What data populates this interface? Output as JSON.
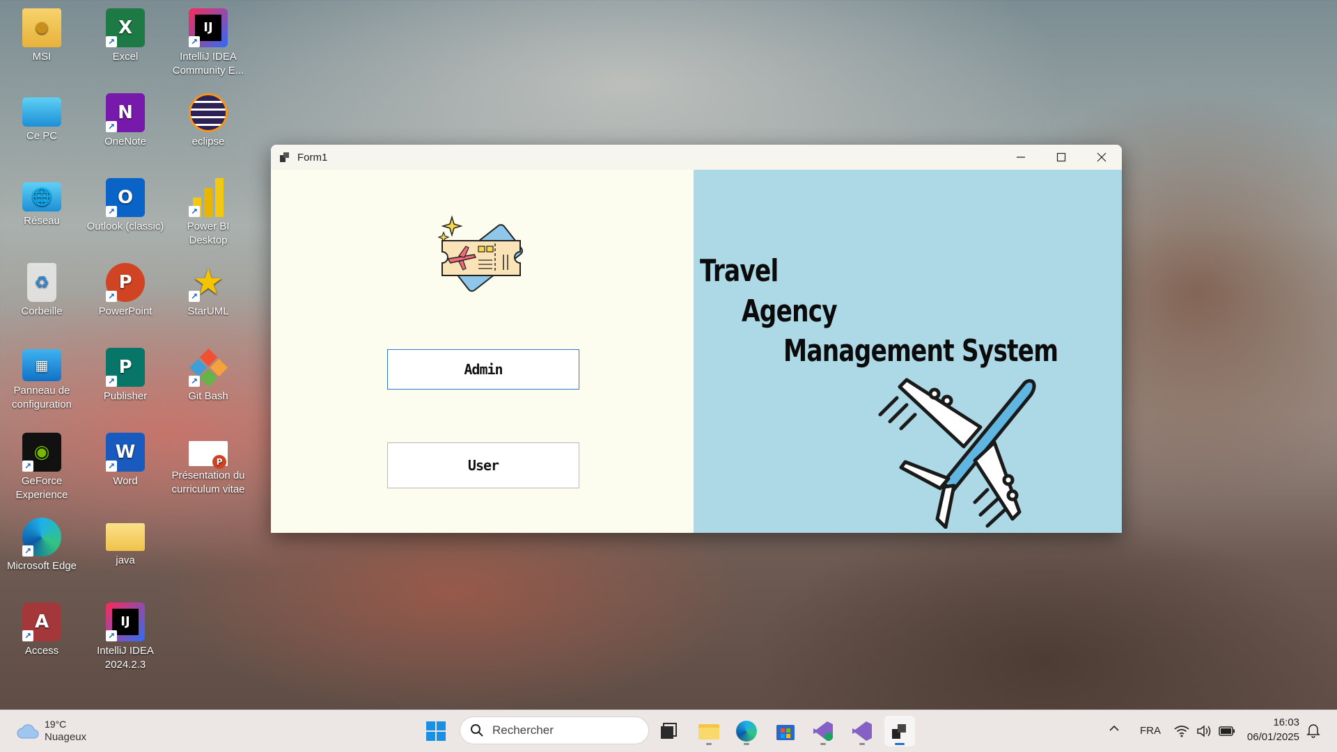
{
  "desktop": {
    "icons": [
      {
        "label": "MSI",
        "icon": "folder-user-icon"
      },
      {
        "label": "Excel",
        "icon": "excel-icon"
      },
      {
        "label": "IntelliJ IDEA Community E...",
        "icon": "intellij-icon"
      },
      {
        "label": "Ce PC",
        "icon": "monitor-icon"
      },
      {
        "label": "OneNote",
        "icon": "onenote-icon"
      },
      {
        "label": "eclipse",
        "icon": "eclipse-icon"
      },
      {
        "label": "Réseau",
        "icon": "network-icon"
      },
      {
        "label": "Outlook (classic)",
        "icon": "outlook-icon"
      },
      {
        "label": "Power BI Desktop",
        "icon": "powerbi-icon"
      },
      {
        "label": "Corbeille",
        "icon": "recycle-bin-icon"
      },
      {
        "label": "PowerPoint",
        "icon": "powerpoint-icon"
      },
      {
        "label": "StarUML",
        "icon": "staruml-icon"
      },
      {
        "label": "Panneau de configuration",
        "icon": "control-panel-icon"
      },
      {
        "label": "Publisher",
        "icon": "publisher-icon"
      },
      {
        "label": "Git Bash",
        "icon": "git-bash-icon"
      },
      {
        "label": "GeForce Experience",
        "icon": "geforce-icon"
      },
      {
        "label": "Word",
        "icon": "word-icon"
      },
      {
        "label": "Présentation du curriculum vitae",
        "icon": "pptx-file-icon"
      },
      {
        "label": "Microsoft Edge",
        "icon": "edge-icon"
      },
      {
        "label": "java",
        "icon": "folder-icon"
      },
      {
        "label": "Access",
        "icon": "access-icon"
      },
      {
        "label": "IntelliJ IDEA 2024.2.3",
        "icon": "intellij-icon"
      }
    ]
  },
  "window": {
    "title": "Form1",
    "buttons": {
      "admin": "Admin",
      "user": "User"
    },
    "headline": {
      "line1": "Travel",
      "line2": "Agency",
      "line3": "Management System"
    }
  },
  "taskbar": {
    "weather": {
      "temp": "19°C",
      "condition": "Nuageux"
    },
    "search_placeholder": "Rechercher",
    "language": "FRA",
    "time": "16:03",
    "date": "06/01/2025"
  }
}
